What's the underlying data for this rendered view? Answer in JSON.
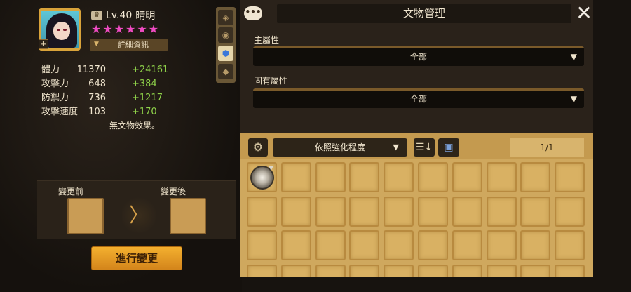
{
  "hero": {
    "level": "Lv.40",
    "name": "晴明",
    "stars": [
      "★",
      "★",
      "★",
      "★",
      "★",
      "★"
    ],
    "details_label": "詳細資訊",
    "stats": [
      {
        "name": "體力",
        "base": "11370",
        "bonus": "+24161"
      },
      {
        "name": "攻擊力",
        "base": "648",
        "bonus": "+384"
      },
      {
        "name": "防禦力",
        "base": "736",
        "bonus": "+1217"
      },
      {
        "name": "攻擊速度",
        "base": "103",
        "bonus": "+170"
      }
    ],
    "no_artifact_text": "無文物效果。"
  },
  "change": {
    "before_label": "變更前",
    "after_label": "變更後",
    "arrow": "〉",
    "apply_label": "進行變更"
  },
  "manage": {
    "title": "文物管理",
    "chat_icon": "•••",
    "close_icon": "✕",
    "main_attr_label": "主屬性",
    "main_attr_value": "全部",
    "fixed_attr_label": "固有屬性",
    "fixed_attr_value": "全部",
    "caret": "▼"
  },
  "inventory": {
    "sort_label": "依照強化程度",
    "sort_caret": "▼",
    "page": "1/1",
    "gear_icon": "⚙",
    "order_icon": "☰↓",
    "bag_icon": "▣"
  },
  "colors": {
    "accent_gold": "#f4b02f",
    "bonus_green": "#8fd24a",
    "star_pink": "#ef4bc2",
    "panel_dark": "#2a221a",
    "inventory_tan": "#cfa85e"
  }
}
